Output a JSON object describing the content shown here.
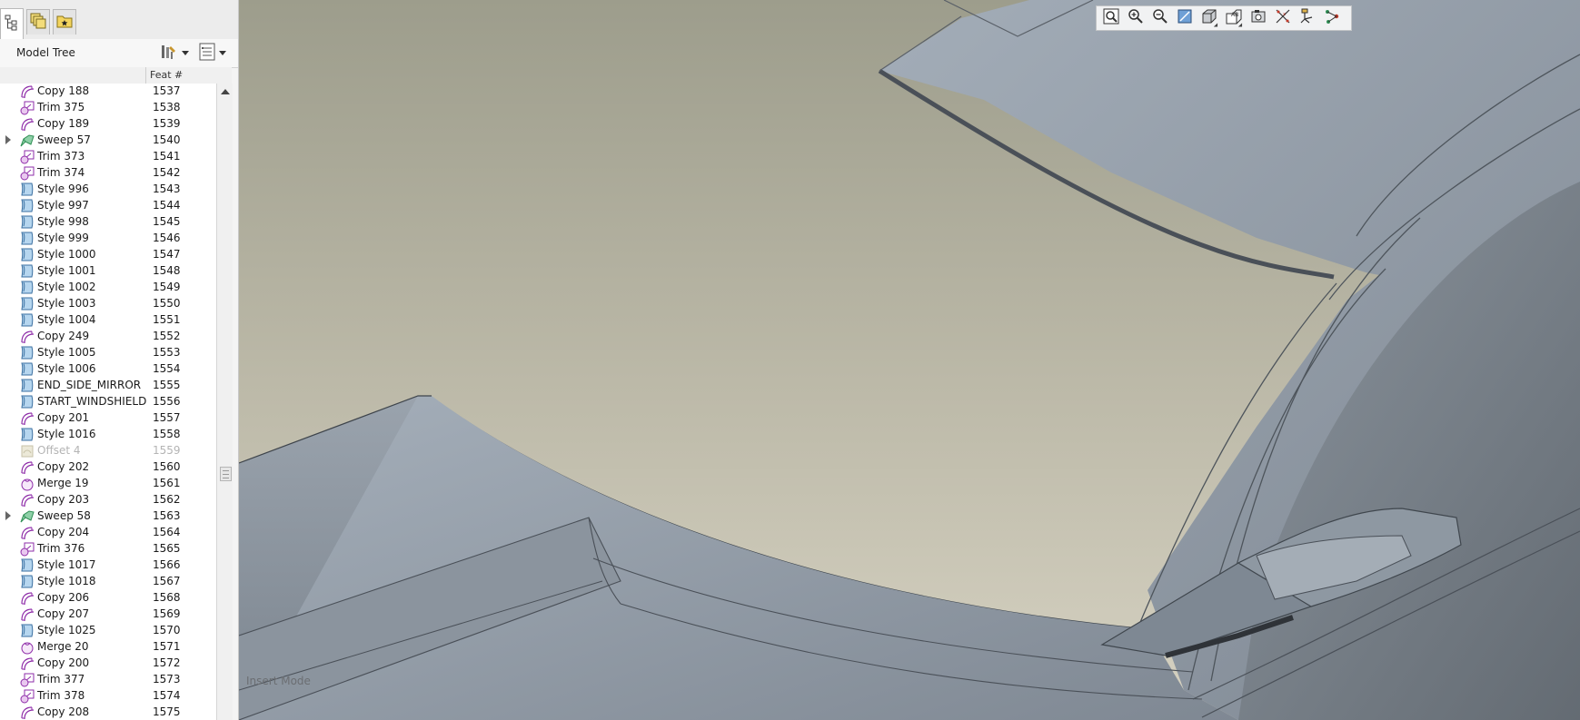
{
  "panel": {
    "tabs": [
      {
        "icon": "model-tree-icon"
      },
      {
        "icon": "layers-icon"
      },
      {
        "icon": "favorites-folder-icon"
      }
    ],
    "title": "Model Tree",
    "settings_icon": "tree-settings-icon",
    "columns_icon": "tree-columns-icon"
  },
  "columns": {
    "name": "",
    "feat": "Feat #"
  },
  "rows": [
    {
      "name": "Copy 188",
      "num": "1537",
      "icon": "copy-icon"
    },
    {
      "name": "Trim 375",
      "num": "1538",
      "icon": "trim-icon"
    },
    {
      "name": "Copy 189",
      "num": "1539",
      "icon": "copy-icon"
    },
    {
      "name": "Sweep 57",
      "num": "1540",
      "icon": "sweep-icon",
      "expand": true
    },
    {
      "name": "Trim 373",
      "num": "1541",
      "icon": "trim-icon"
    },
    {
      "name": "Trim 374",
      "num": "1542",
      "icon": "trim-icon"
    },
    {
      "name": "Style 996",
      "num": "1543",
      "icon": "style-icon"
    },
    {
      "name": "Style 997",
      "num": "1544",
      "icon": "style-icon"
    },
    {
      "name": "Style 998",
      "num": "1545",
      "icon": "style-icon"
    },
    {
      "name": "Style 999",
      "num": "1546",
      "icon": "style-icon"
    },
    {
      "name": "Style 1000",
      "num": "1547",
      "icon": "style-icon"
    },
    {
      "name": "Style 1001",
      "num": "1548",
      "icon": "style-icon"
    },
    {
      "name": "Style 1002",
      "num": "1549",
      "icon": "style-icon"
    },
    {
      "name": "Style 1003",
      "num": "1550",
      "icon": "style-icon"
    },
    {
      "name": "Style 1004",
      "num": "1551",
      "icon": "style-icon"
    },
    {
      "name": "Copy 249",
      "num": "1552",
      "icon": "copy-icon"
    },
    {
      "name": "Style 1005",
      "num": "1553",
      "icon": "style-icon"
    },
    {
      "name": "Style 1006",
      "num": "1554",
      "icon": "style-icon"
    },
    {
      "name": "END_SIDE_MIRROR",
      "num": "1555",
      "icon": "style-icon"
    },
    {
      "name": "START_WINDSHIELD",
      "num": "1556",
      "icon": "style-icon"
    },
    {
      "name": "Copy 201",
      "num": "1557",
      "icon": "copy-icon"
    },
    {
      "name": "Style 1016",
      "num": "1558",
      "icon": "style-icon"
    },
    {
      "name": "Offset 4",
      "num": "1559",
      "icon": "offset-icon",
      "dim": true
    },
    {
      "name": "Copy 202",
      "num": "1560",
      "icon": "copy-icon"
    },
    {
      "name": "Merge 19",
      "num": "1561",
      "icon": "merge-icon"
    },
    {
      "name": "Copy 203",
      "num": "1562",
      "icon": "copy-icon"
    },
    {
      "name": "Sweep 58",
      "num": "1563",
      "icon": "sweep-icon",
      "expand": true
    },
    {
      "name": "Copy 204",
      "num": "1564",
      "icon": "copy-icon"
    },
    {
      "name": "Trim 376",
      "num": "1565",
      "icon": "trim-icon"
    },
    {
      "name": "Style 1017",
      "num": "1566",
      "icon": "style-icon"
    },
    {
      "name": "Style 1018",
      "num": "1567",
      "icon": "style-icon"
    },
    {
      "name": "Copy 206",
      "num": "1568",
      "icon": "copy-icon"
    },
    {
      "name": "Copy 207",
      "num": "1569",
      "icon": "copy-icon"
    },
    {
      "name": "Style 1025",
      "num": "1570",
      "icon": "style-icon"
    },
    {
      "name": "Merge 20",
      "num": "1571",
      "icon": "merge-icon"
    },
    {
      "name": "Copy 200",
      "num": "1572",
      "icon": "copy-icon"
    },
    {
      "name": "Trim 377",
      "num": "1573",
      "icon": "trim-icon"
    },
    {
      "name": "Trim 378",
      "num": "1574",
      "icon": "trim-icon"
    },
    {
      "name": "Copy 208",
      "num": "1575",
      "icon": "copy-icon"
    }
  ],
  "toolbar": [
    {
      "name": "refit-icon"
    },
    {
      "name": "zoom-in-icon"
    },
    {
      "name": "zoom-out-icon"
    },
    {
      "name": "repaint-icon"
    },
    {
      "name": "display-style-icon",
      "sub": true
    },
    {
      "name": "saved-views-icon",
      "sub": true
    },
    {
      "name": "view-manager-icon"
    },
    {
      "name": "datum-display-icon"
    },
    {
      "name": "spin-center-icon"
    },
    {
      "name": "annotation-display-icon"
    }
  ],
  "viewport": {
    "mode_label": "Insert Mode"
  },
  "colors": {
    "selection_purple": "#8e2ca8",
    "surface_blue": "#7aa7cc",
    "sweep_green": "#2f8f55"
  }
}
